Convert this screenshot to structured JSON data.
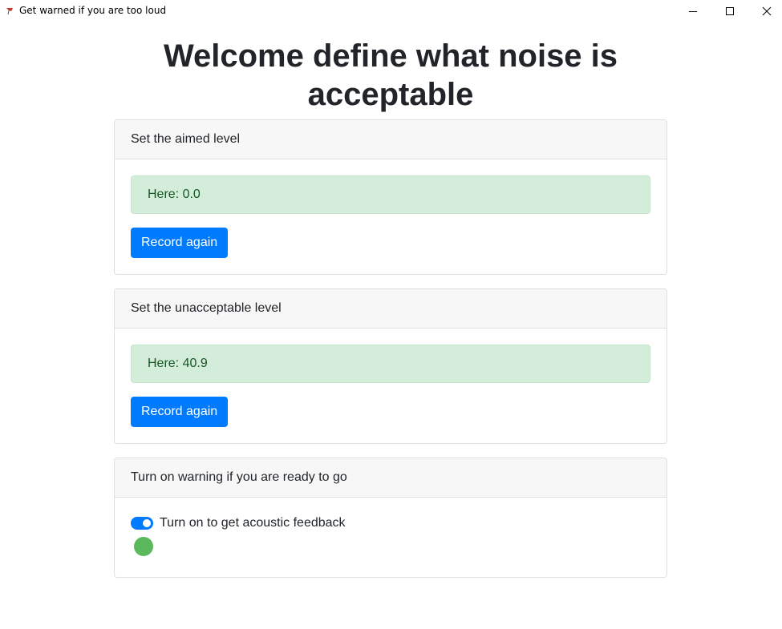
{
  "window": {
    "title": "Get warned if you are too loud"
  },
  "page": {
    "heading": "Welcome define what noise is acceptable"
  },
  "cards": [
    {
      "header": "Set the aimed level",
      "value_text": "Here: 0.0",
      "button_label": "Record again"
    },
    {
      "header": "Set the unacceptable level",
      "value_text": "Here: 40.9",
      "button_label": "Record again"
    }
  ],
  "warning": {
    "header": "Turn on warning if you are ready to go",
    "switch_label": "Turn on to get acoustic feedback",
    "switch_on": true,
    "indicator_color": "#5cb85c"
  },
  "colors": {
    "primary": "#007bff",
    "success_bg": "#d4edda",
    "success_text": "#155724"
  }
}
